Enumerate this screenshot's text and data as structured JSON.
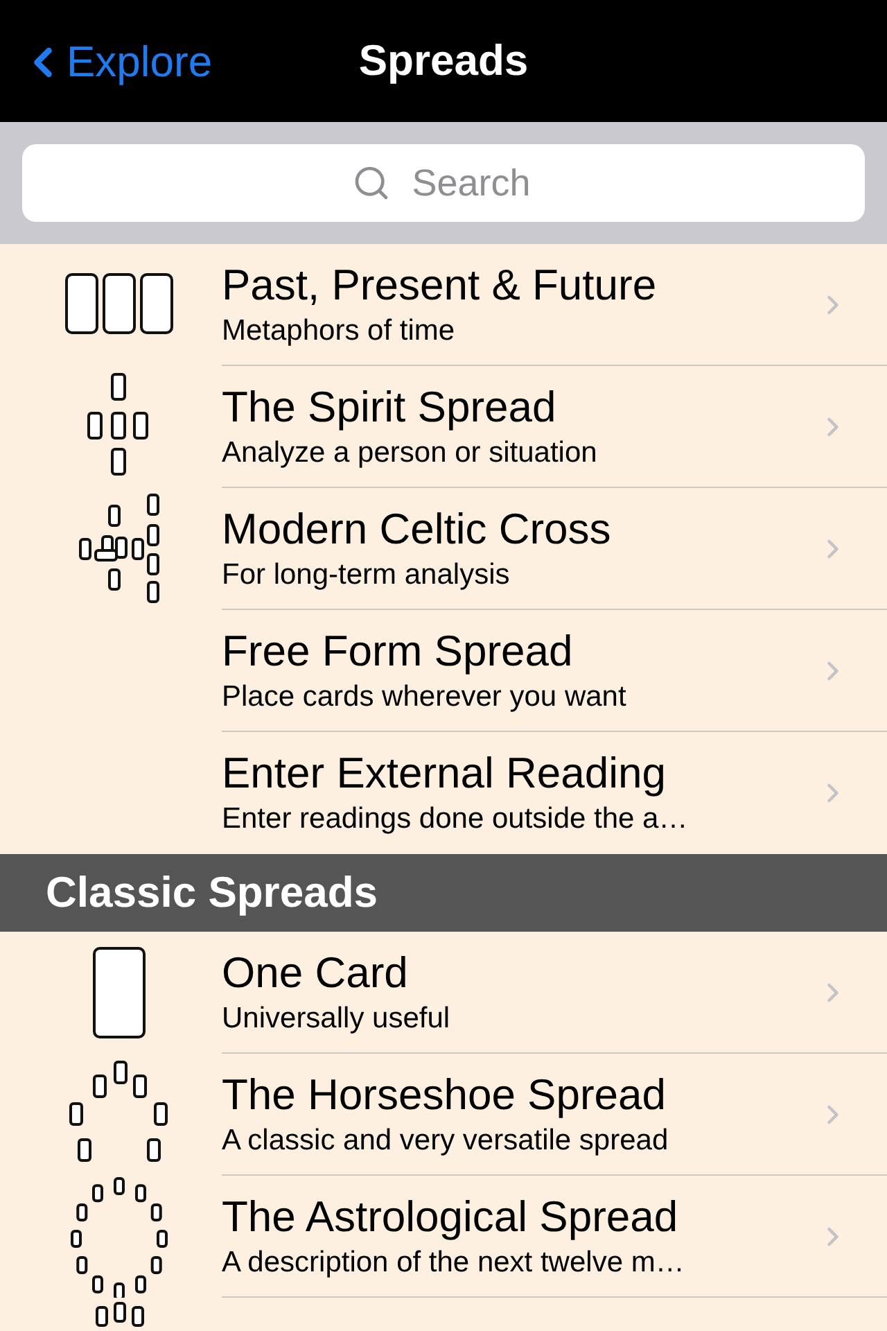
{
  "nav": {
    "back": "Explore",
    "title": "Spreads"
  },
  "search": {
    "placeholder": "Search"
  },
  "sections": [
    {
      "items": [
        {
          "kind": "three",
          "title": "Past, Present & Future",
          "subtitle": "Metaphors of time"
        },
        {
          "kind": "spirit",
          "title": "The Spirit Spread",
          "subtitle": "Analyze a person or situation"
        },
        {
          "kind": "celtic",
          "title": "Modern Celtic Cross",
          "subtitle": "For long-term analysis"
        },
        {
          "kind": "plain",
          "title": "Free Form Spread",
          "subtitle": "Place cards wherever you want"
        },
        {
          "kind": "plain",
          "title": "Enter External Reading",
          "subtitle": "Enter readings done outside the a…"
        }
      ]
    },
    {
      "header": "Classic Spreads",
      "items": [
        {
          "kind": "one",
          "title": "One Card",
          "subtitle": "Universally useful"
        },
        {
          "kind": "horseshoe",
          "title": "The Horseshoe Spread",
          "subtitle": "A classic and very versatile spread"
        },
        {
          "kind": "astro",
          "title": "The Astrological Spread",
          "subtitle": "A description of the next twelve m…"
        },
        {
          "kind": "tree"
        }
      ]
    }
  ]
}
